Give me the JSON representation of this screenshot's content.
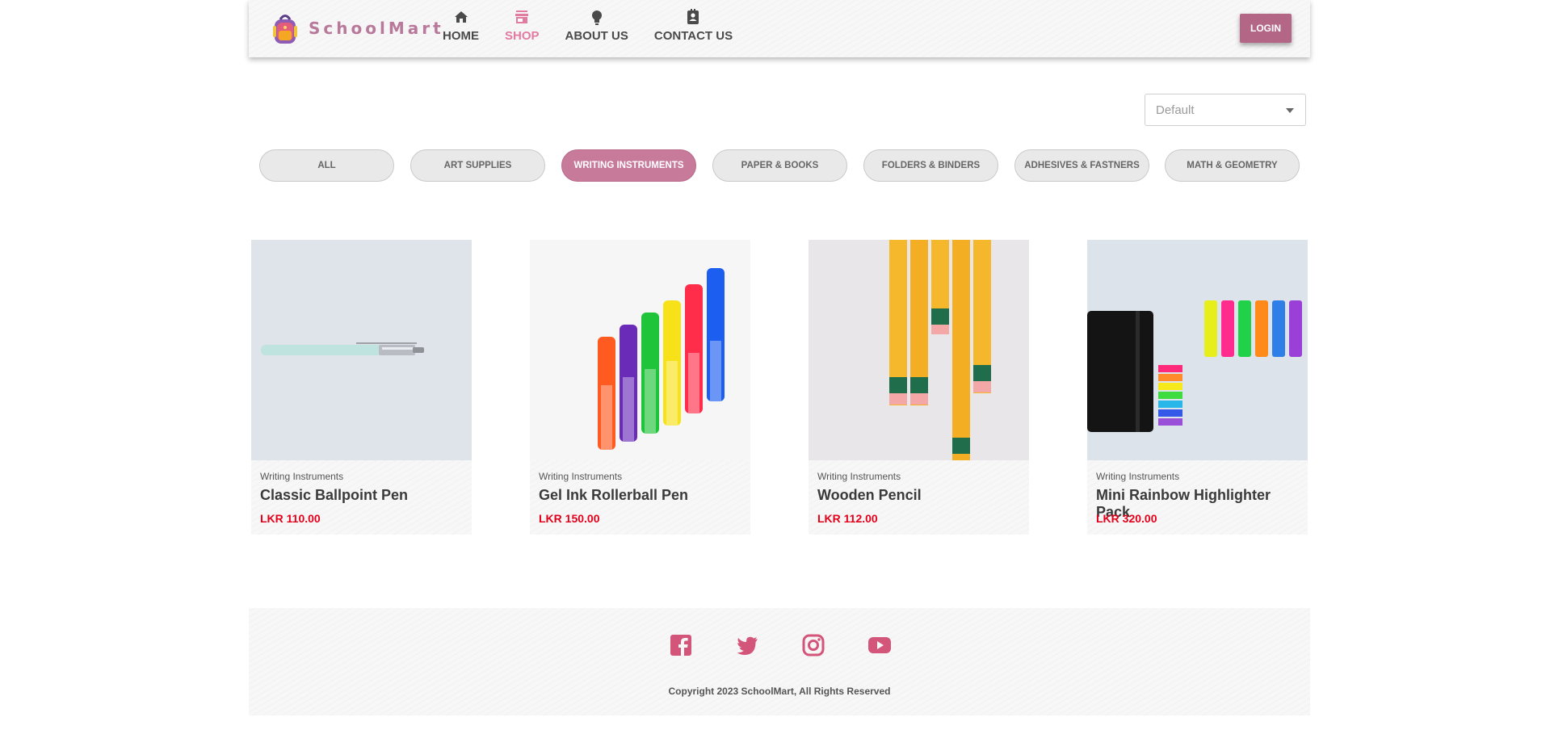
{
  "brand": {
    "name": "SchoolMart"
  },
  "nav": {
    "items": [
      {
        "label": "HOME",
        "icon": "home-icon"
      },
      {
        "label": "SHOP",
        "icon": "store-icon",
        "active": true
      },
      {
        "label": "ABOUT US",
        "icon": "lightbulb-icon"
      },
      {
        "label": "CONTACT US",
        "icon": "contact-card-icon"
      }
    ],
    "login_label": "LOGIN"
  },
  "sort": {
    "selected": "Default"
  },
  "categories": [
    {
      "label": "ALL"
    },
    {
      "label": "ART SUPPLIES"
    },
    {
      "label": "WRITING INSTRUMENTS",
      "active": true
    },
    {
      "label": "PAPER & BOOKS"
    },
    {
      "label": "FOLDERS & BINDERS"
    },
    {
      "label": "ADHESIVES & FASTNERS"
    },
    {
      "label": "MATH & GEOMETRY"
    }
  ],
  "products": [
    {
      "category": "Writing Instruments",
      "name": "Classic Ballpoint Pen",
      "price": "LKR 110.00"
    },
    {
      "category": "Writing Instruments",
      "name": "Gel Ink Rollerball Pen",
      "price": "LKR 150.00"
    },
    {
      "category": "Writing Instruments",
      "name": "Wooden Pencil",
      "price": "LKR 112.00"
    },
    {
      "category": "Writing Instruments",
      "name": "Mini Rainbow Highlighter Pack",
      "price": "LKR 320.00"
    }
  ],
  "footer": {
    "socials": [
      "facebook-icon",
      "twitter-icon",
      "instagram-icon",
      "youtube-icon"
    ],
    "copyright": "Copyright 2023 SchoolMart, All Rights Reserved"
  },
  "colors": {
    "brand_pink": "#b8799a",
    "active_nav": "#e27ba2",
    "login_bg": "#b36685",
    "active_pill": "#c87a9b",
    "price_red": "#e3001b",
    "social_pink": "#d4557a"
  }
}
